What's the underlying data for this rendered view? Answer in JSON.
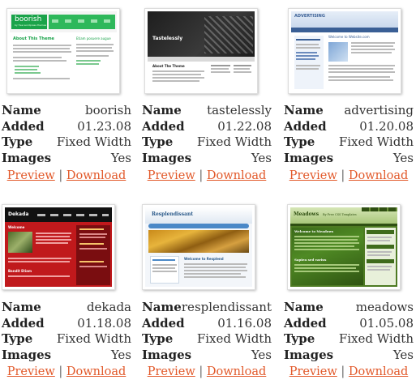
{
  "labels": {
    "name": "Name",
    "added": "Added",
    "type": "Type",
    "images": "Images",
    "preview": "Preview",
    "download": "Download",
    "sep": "|"
  },
  "themes": [
    {
      "name": "boorish",
      "added": "01.23.08",
      "type": "Fixed Width",
      "images": "Yes",
      "shot": {
        "logo": "boorish",
        "tagline": "by free wordpress themes",
        "heading": "About This Theme",
        "side_heading": "Etiam posuere augue"
      }
    },
    {
      "name": "tastelessly",
      "added": "01.22.08",
      "type": "Fixed Width",
      "images": "Yes",
      "shot": {
        "logo": "Tastelessly",
        "heading": "About The Theme"
      }
    },
    {
      "name": "advertising",
      "added": "01.20.08",
      "type": "Fixed Width",
      "images": "Yes",
      "shot": {
        "logo": "ADVERTISING",
        "heading": "Welcome to Website.com"
      }
    },
    {
      "name": "dekada",
      "added": "01.18.08",
      "type": "Fixed Width",
      "images": "Yes",
      "shot": {
        "logo": "Dekada",
        "heading": "Welcome",
        "footer_heading": "Bandit Etiam"
      }
    },
    {
      "name": "resplendissant",
      "added": "01.16.08",
      "type": "Fixed Width",
      "images": "Yes",
      "shot": {
        "logo": "Resplendissant",
        "heading": "Welcome to Resplend"
      }
    },
    {
      "name": "meadows",
      "added": "01.05.08",
      "type": "Fixed Width",
      "images": "Yes",
      "shot": {
        "logo": "Meadows",
        "tagline": "By Free CSS Templates",
        "heading": "Welcome to Meadows",
        "heading2": "Sapien sed varius"
      }
    }
  ],
  "colors": {
    "link": "#e2592a",
    "boorish_green": "#1aa34a",
    "dekada_red": "#c0191c",
    "meadows_green": "#3f6b1c",
    "advertising_blue": "#3a5f95"
  }
}
